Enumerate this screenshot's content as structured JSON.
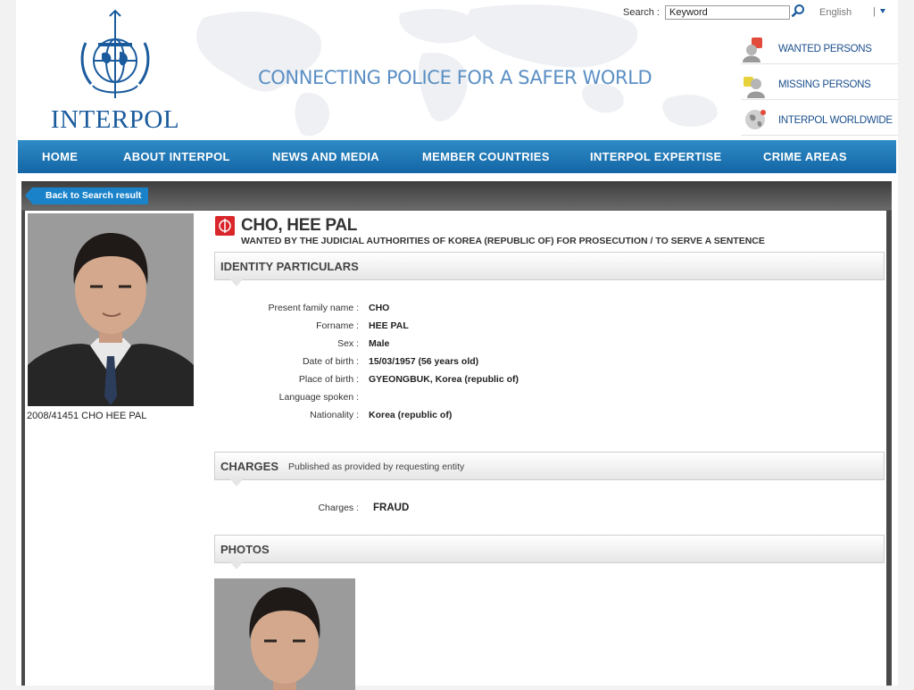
{
  "header": {
    "logo_text": "INTERPOL",
    "seal_text": "INTERPOL OIPC ICPO",
    "tagline": "CONNECTING POLICE FOR A SAFER WORLD",
    "search": {
      "label": "Search :",
      "value": "Keyword"
    },
    "language": {
      "selected": "English",
      "separator": "|"
    },
    "quick_links": [
      {
        "label": "WANTED PERSONS",
        "icon": "wanted-person-icon"
      },
      {
        "label": "MISSING PERSONS",
        "icon": "missing-person-icon"
      },
      {
        "label": "INTERPOL WORLDWIDE",
        "icon": "globe-icon"
      }
    ]
  },
  "nav": [
    {
      "label": "HOME"
    },
    {
      "label": "ABOUT INTERPOL"
    },
    {
      "label": "NEWS AND MEDIA"
    },
    {
      "label": "MEMBER COUNTRIES"
    },
    {
      "label": "INTERPOL EXPERTISE"
    },
    {
      "label": "CRIME AREAS"
    }
  ],
  "content": {
    "back_button": "Back to Search result",
    "photo_caption": "2008/41451 CHO HEE PAL",
    "name": "CHO, HEE PAL",
    "wanted_by": "WANTED BY THE JUDICIAL AUTHORITIES OF KOREA (REPUBLIC OF) FOR PROSECUTION / TO SERVE A SENTENCE",
    "identity": {
      "title": "IDENTITY PARTICULARS",
      "rows": [
        {
          "label": "Present family name :",
          "value": "CHO"
        },
        {
          "label": "Forname :",
          "value": "HEE PAL"
        },
        {
          "label": "Sex :",
          "value": "Male"
        },
        {
          "label": "Date of birth :",
          "value": "15/03/1957 (56 years old)"
        },
        {
          "label": "Place of birth :",
          "value": "GYEONGBUK, Korea (republic of)"
        },
        {
          "label": "Language spoken :",
          "value": ""
        },
        {
          "label": "Nationality :",
          "value": "Korea (republic of)"
        }
      ]
    },
    "charges": {
      "title": "CHARGES",
      "subtitle": "Published as provided by requesting entity",
      "label": "Charges :",
      "value": "FRAUD"
    },
    "photos": {
      "title": "PHOTOS"
    }
  },
  "colors": {
    "nav_blue": "#1466a5",
    "brand_blue": "#1a5b9d",
    "button_blue": "#1a82c8",
    "notice_red": "#d9262b"
  }
}
